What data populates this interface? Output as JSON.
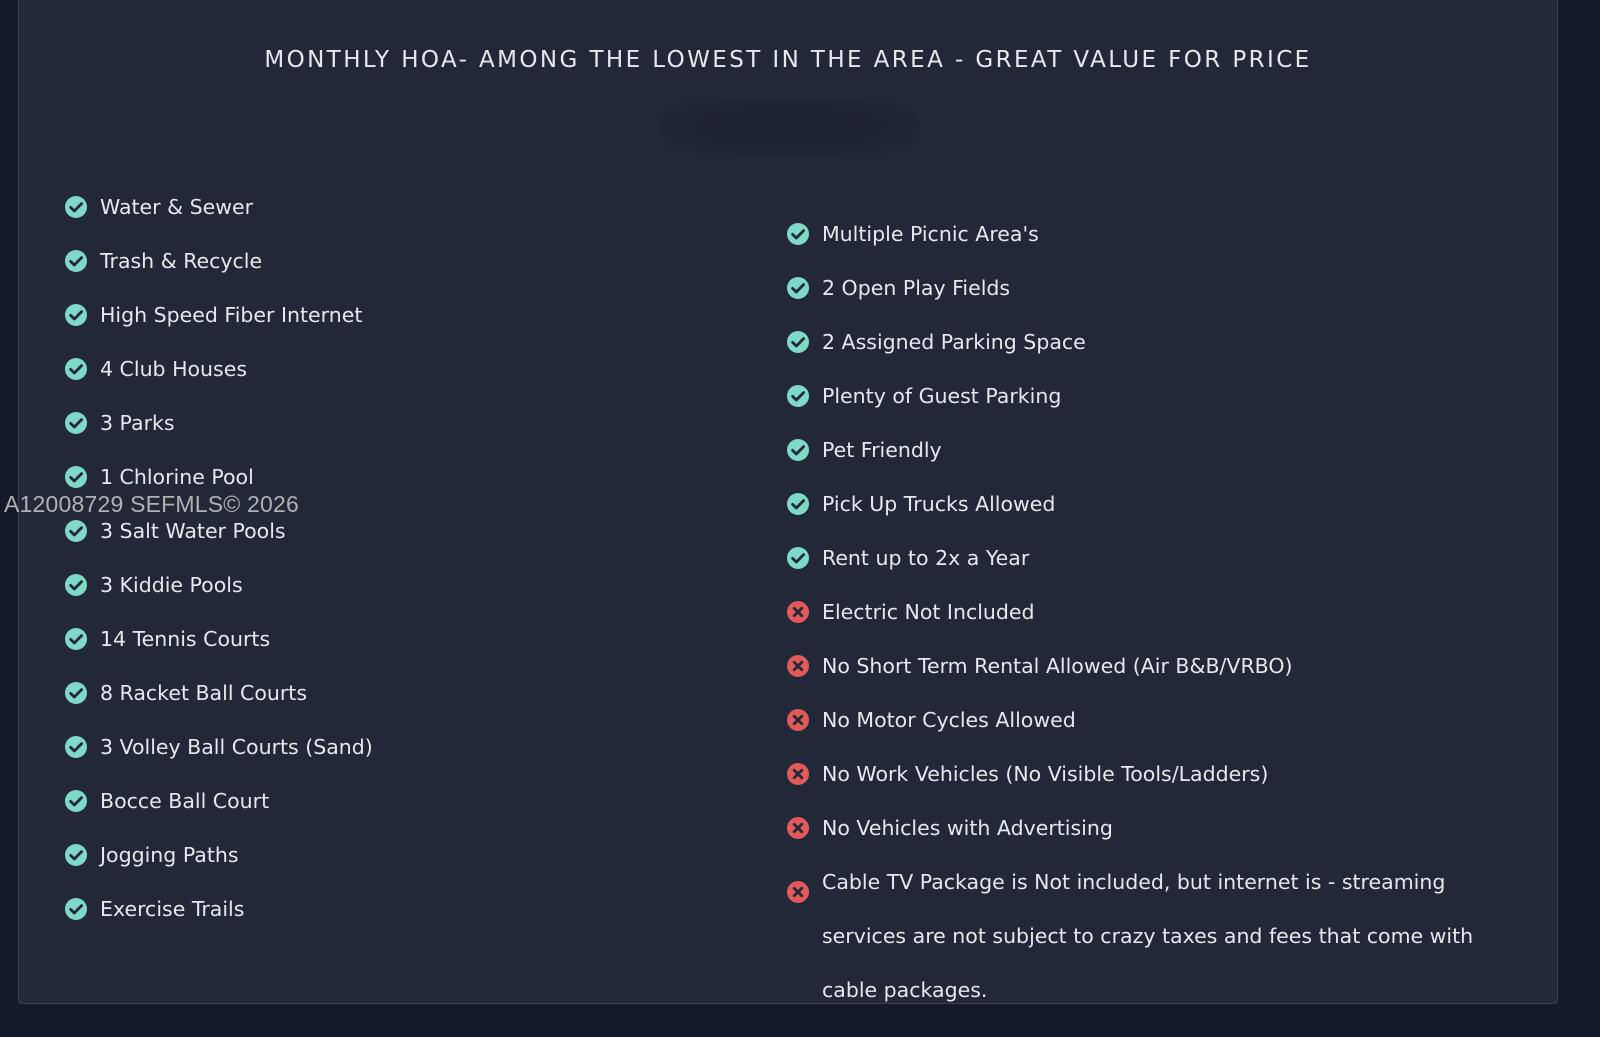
{
  "colors": {
    "background": "#151a2b",
    "panel": "#232838",
    "text": "#e6e8ee",
    "included_icon": "#7fd9c9",
    "excluded_icon": "#e05a5a"
  },
  "title": "MONTHLY HOA- AMONG THE LOWEST IN THE AREA - GREAT VALUE FOR PRICE",
  "watermark": "A12008729  SEFMLS© 2026",
  "left_items": [
    {
      "label": "Water & Sewer",
      "status": "included",
      "icon": "check-circle-icon"
    },
    {
      "label": "Trash & Recycle",
      "status": "included",
      "icon": "check-circle-icon"
    },
    {
      "label": "High Speed Fiber Internet",
      "status": "included",
      "icon": "check-circle-icon"
    },
    {
      "label": "4 Club Houses",
      "status": "included",
      "icon": "check-circle-icon"
    },
    {
      "label": "3 Parks",
      "status": "included",
      "icon": "check-circle-icon"
    },
    {
      "label": "1 Chlorine Pool",
      "status": "included",
      "icon": "check-circle-icon"
    },
    {
      "label": "3 Salt Water Pools",
      "status": "included",
      "icon": "check-circle-icon"
    },
    {
      "label": "3 Kiddie Pools",
      "status": "included",
      "icon": "check-circle-icon"
    },
    {
      "label": "14 Tennis Courts",
      "status": "included",
      "icon": "check-circle-icon"
    },
    {
      "label": "8 Racket Ball Courts",
      "status": "included",
      "icon": "check-circle-icon"
    },
    {
      "label": "3 Volley Ball Courts (Sand)",
      "status": "included",
      "icon": "check-circle-icon"
    },
    {
      "label": "Bocce Ball Court",
      "status": "included",
      "icon": "check-circle-icon"
    },
    {
      "label": "Jogging Paths",
      "status": "included",
      "icon": "check-circle-icon"
    },
    {
      "label": "Exercise Trails",
      "status": "included",
      "icon": "check-circle-icon"
    }
  ],
  "right_items": [
    {
      "label": "Multiple Picnic Area's",
      "status": "included",
      "icon": "check-circle-icon"
    },
    {
      "label": "2 Open Play Fields",
      "status": "included",
      "icon": "check-circle-icon"
    },
    {
      "label": "2 Assigned Parking Space",
      "status": "included",
      "icon": "check-circle-icon"
    },
    {
      "label": "Plenty of Guest Parking",
      "status": "included",
      "icon": "check-circle-icon"
    },
    {
      "label": "Pet Friendly",
      "status": "included",
      "icon": "check-circle-icon"
    },
    {
      "label": "Pick Up Trucks Allowed",
      "status": "included",
      "icon": "check-circle-icon"
    },
    {
      "label": "Rent up to 2x a Year",
      "status": "included",
      "icon": "check-circle-icon"
    },
    {
      "label": "Electric Not Included",
      "status": "excluded",
      "icon": "x-circle-icon"
    },
    {
      "label": "No Short Term Rental Allowed (Air B&B/VRBO)",
      "status": "excluded",
      "icon": "x-circle-icon"
    },
    {
      "label": "No Motor Cycles Allowed",
      "status": "excluded",
      "icon": "x-circle-icon"
    },
    {
      "label": "No Work Vehicles (No Visible Tools/Ladders)",
      "status": "excluded",
      "icon": "x-circle-icon"
    },
    {
      "label": "No Vehicles with Advertising",
      "status": "excluded",
      "icon": "x-circle-icon"
    },
    {
      "label": "Cable TV Package is Not included, but internet is - streaming services are not subject to crazy taxes and fees that come with cable packages.",
      "status": "excluded",
      "icon": "x-circle-icon",
      "wrap": true
    }
  ]
}
